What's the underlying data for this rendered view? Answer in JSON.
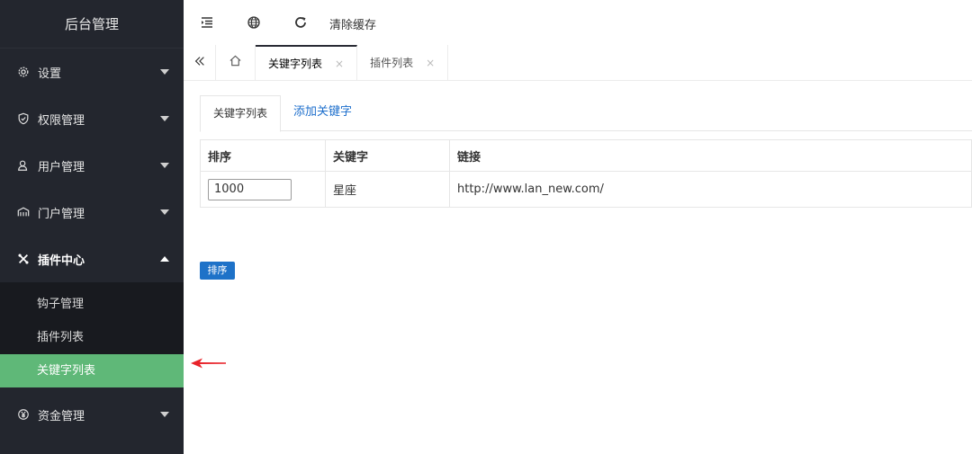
{
  "sidebar": {
    "brand": "后台管理",
    "items": [
      {
        "label": "设置"
      },
      {
        "label": "权限管理"
      },
      {
        "label": "用户管理"
      },
      {
        "label": "门户管理"
      },
      {
        "label": "插件中心"
      },
      {
        "label": "资金管理"
      }
    ],
    "submenu": [
      {
        "label": "钩子管理"
      },
      {
        "label": "插件列表"
      },
      {
        "label": "关键字列表"
      }
    ]
  },
  "topbar": {
    "clear_cache": "清除缓存"
  },
  "tabs": [
    {
      "label": "关键字列表",
      "close": "×"
    },
    {
      "label": "插件列表",
      "close": "×"
    }
  ],
  "content": {
    "subtabs": {
      "list": "关键字列表",
      "add": "添加关键字"
    },
    "table": {
      "headers": [
        "排序",
        "关键字",
        "链接"
      ],
      "rows": [
        {
          "order": "1000",
          "keyword": "星座",
          "link": "http://www.lan_new.com/"
        }
      ]
    },
    "sort_button": "排序"
  },
  "colors": {
    "sidebar_bg": "#23262e",
    "active_green": "#5fb878",
    "link_blue": "#1e6fcc",
    "button_blue": "#1e72c8",
    "arrow_red": "#e8232a"
  }
}
